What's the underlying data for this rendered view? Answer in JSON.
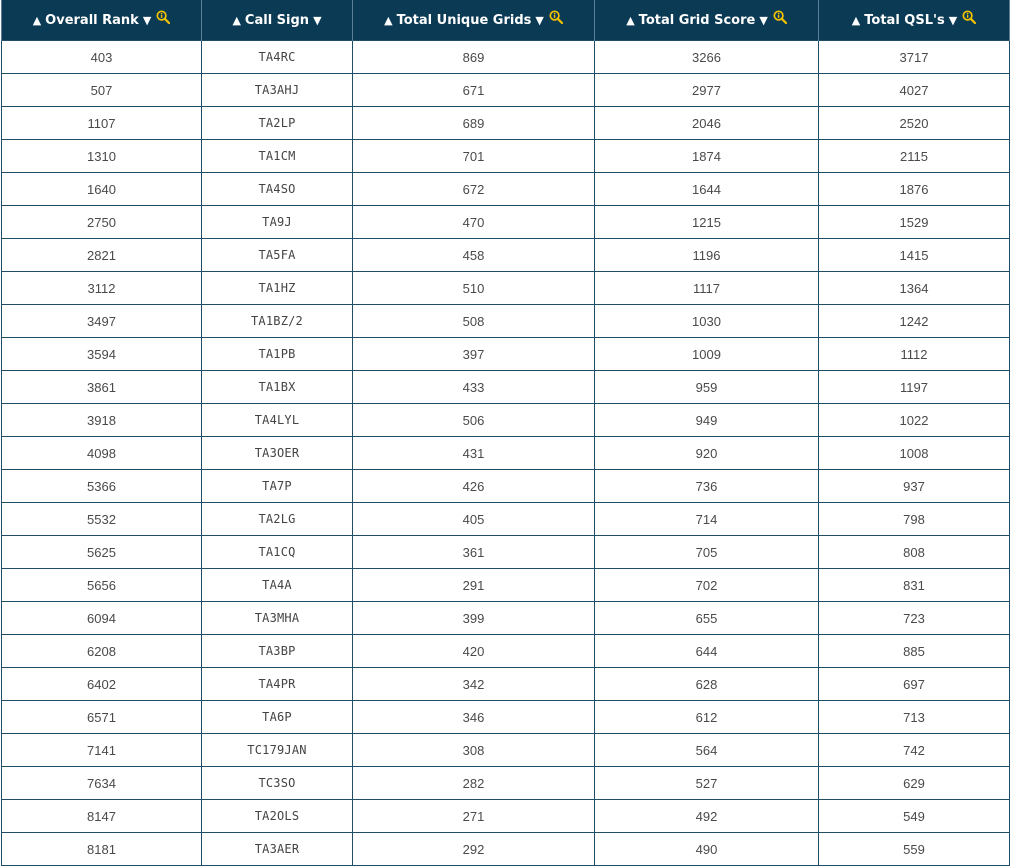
{
  "columns": [
    {
      "label": "Overall Rank",
      "sort_up": "▲",
      "sort_down": "▼",
      "has_zoom": true
    },
    {
      "label": "Call Sign",
      "sort_up": "▲",
      "sort_down": "▼",
      "has_zoom": false
    },
    {
      "label": "Total Unique Grids",
      "sort_up": "▲",
      "sort_down": "▼",
      "has_zoom": true
    },
    {
      "label": "Total Grid Score",
      "sort_up": "▲",
      "sort_down": "▼",
      "has_zoom": true
    },
    {
      "label": "Total QSL's",
      "sort_up": "▲",
      "sort_down": "▼",
      "has_zoom": true
    }
  ],
  "icons": {
    "zoom": "magnifier-info-icon",
    "sort_up": "triangle-up-icon",
    "sort_down": "triangle-down-icon"
  },
  "colors": {
    "header_bg": "#0b3a55",
    "header_text": "#ffffff",
    "grid_line": "#1f4c67",
    "zoom_icon": "#f2c200"
  },
  "rows": [
    [
      "403",
      "TA4RC",
      "869",
      "3266",
      "3717"
    ],
    [
      "507",
      "TA3AHJ",
      "671",
      "2977",
      "4027"
    ],
    [
      "1107",
      "TA2LP",
      "689",
      "2046",
      "2520"
    ],
    [
      "1310",
      "TA1CM",
      "701",
      "1874",
      "2115"
    ],
    [
      "1640",
      "TA4SO",
      "672",
      "1644",
      "1876"
    ],
    [
      "2750",
      "TA9J",
      "470",
      "1215",
      "1529"
    ],
    [
      "2821",
      "TA5FA",
      "458",
      "1196",
      "1415"
    ],
    [
      "3112",
      "TA1HZ",
      "510",
      "1117",
      "1364"
    ],
    [
      "3497",
      "TA1BZ/2",
      "508",
      "1030",
      "1242"
    ],
    [
      "3594",
      "TA1PB",
      "397",
      "1009",
      "1112"
    ],
    [
      "3861",
      "TA1BX",
      "433",
      "959",
      "1197"
    ],
    [
      "3918",
      "TA4LYL",
      "506",
      "949",
      "1022"
    ],
    [
      "4098",
      "TA3OER",
      "431",
      "920",
      "1008"
    ],
    [
      "5366",
      "TA7P",
      "426",
      "736",
      "937"
    ],
    [
      "5532",
      "TA2LG",
      "405",
      "714",
      "798"
    ],
    [
      "5625",
      "TA1CQ",
      "361",
      "705",
      "808"
    ],
    [
      "5656",
      "TA4A",
      "291",
      "702",
      "831"
    ],
    [
      "6094",
      "TA3MHA",
      "399",
      "655",
      "723"
    ],
    [
      "6208",
      "TA3BP",
      "420",
      "644",
      "885"
    ],
    [
      "6402",
      "TA4PR",
      "342",
      "628",
      "697"
    ],
    [
      "6571",
      "TA6P",
      "346",
      "612",
      "713"
    ],
    [
      "7141",
      "TC179JAN",
      "308",
      "564",
      "742"
    ],
    [
      "7634",
      "TC3SO",
      "282",
      "527",
      "629"
    ],
    [
      "8147",
      "TA2OLS",
      "271",
      "492",
      "549"
    ],
    [
      "8181",
      "TA3AER",
      "292",
      "490",
      "559"
    ]
  ]
}
